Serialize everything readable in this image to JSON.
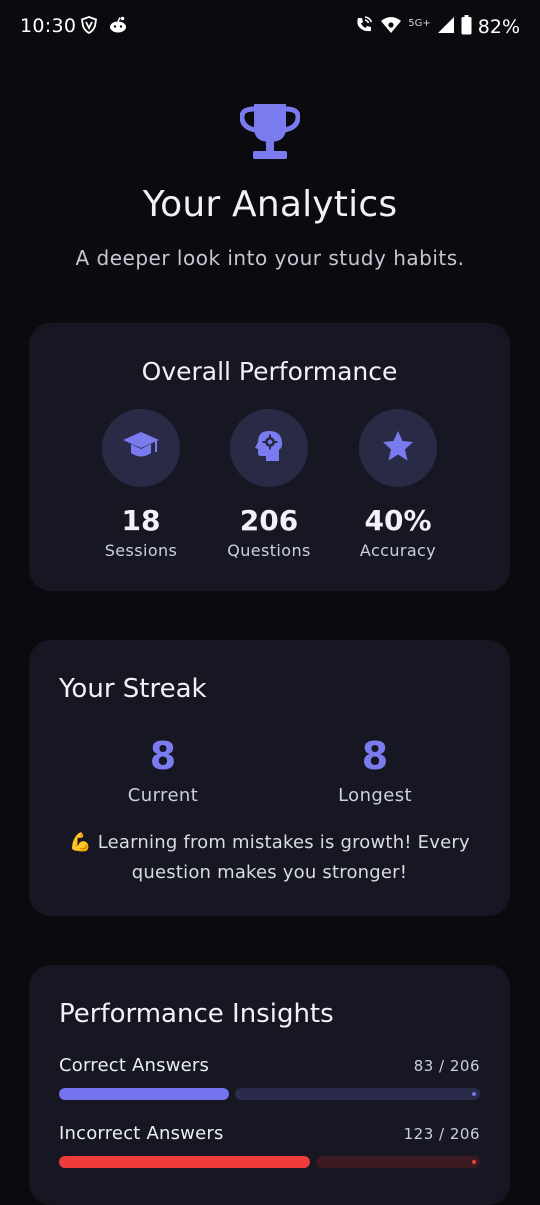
{
  "status_bar": {
    "time": "10:30",
    "network": "5G+",
    "battery": "82%"
  },
  "header": {
    "icon": "trophy-icon",
    "title": "Your Analytics",
    "subtitle": "A deeper look into your study habits."
  },
  "overall_performance": {
    "title": "Overall Performance",
    "stats": [
      {
        "icon": "graduation-cap-icon",
        "value": "18",
        "label": "Sessions"
      },
      {
        "icon": "brain-gear-icon",
        "value": "206",
        "label": "Questions"
      },
      {
        "icon": "star-icon",
        "value": "40%",
        "label": "Accuracy"
      }
    ]
  },
  "streak": {
    "title": "Your Streak",
    "current_value": "8",
    "current_label": "Current",
    "longest_value": "8",
    "longest_label": "Longest",
    "message": "💪 Learning from mistakes is growth! Every question makes you stronger!"
  },
  "insights": {
    "title": "Performance Insights",
    "rows": [
      {
        "label": "Correct Answers",
        "count_text": "83 / 206",
        "correct": 83,
        "total": 206,
        "fill_color": "#7474ee",
        "track_color": "#2a2b4b",
        "dot_color": "#7474ee"
      },
      {
        "label": "Incorrect Answers",
        "count_text": "123 / 206",
        "correct": 123,
        "total": 206,
        "fill_color": "#ee3b3b",
        "track_color": "#3b1a22",
        "dot_color": "#ee3b3b"
      }
    ]
  },
  "colors": {
    "accent": "#7b7bf0",
    "background": "#0b0b0f",
    "card": "#161722",
    "icon_circle": "#292b46"
  }
}
